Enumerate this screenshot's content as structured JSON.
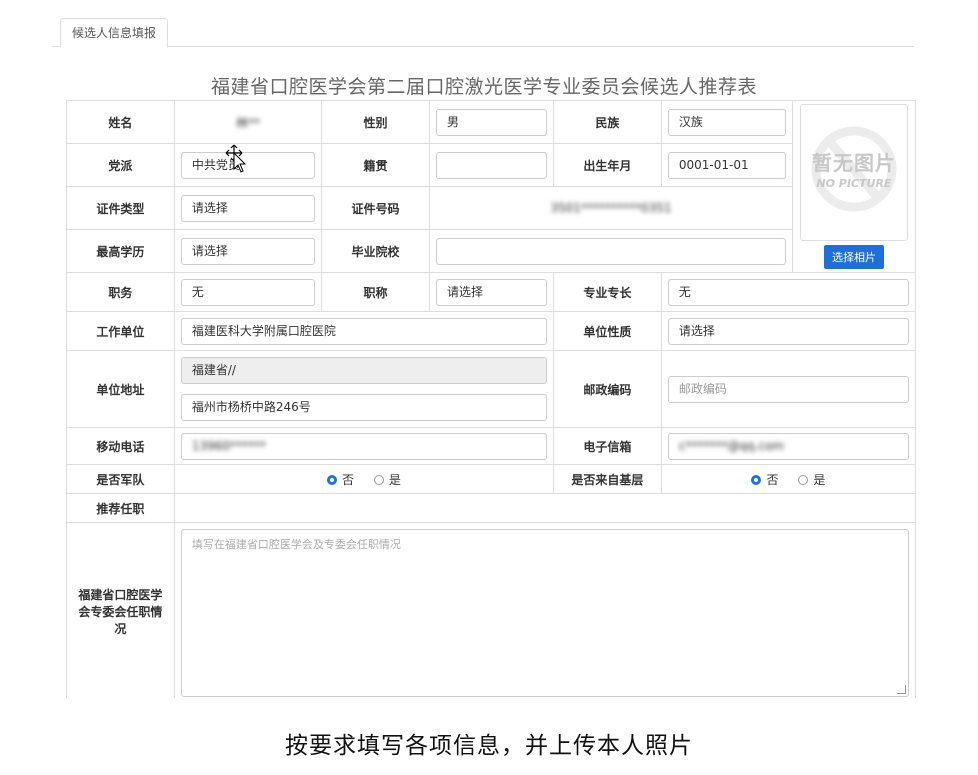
{
  "tab": {
    "label": "候选人信息填报"
  },
  "form_title": "福建省口腔医学会第二届口腔激光医学专业委员会候选人推荐表",
  "fields": {
    "name": {
      "label": "姓名",
      "value": "林**"
    },
    "gender": {
      "label": "性别",
      "value": "男"
    },
    "ethnicity": {
      "label": "民族",
      "value": "汉族"
    },
    "party": {
      "label": "党派",
      "value": "中共党员"
    },
    "hometown": {
      "label": "籍贯",
      "value": ""
    },
    "birth": {
      "label": "出生年月",
      "value": "0001-01-01"
    },
    "id_type": {
      "label": "证件类型",
      "value": "请选择"
    },
    "id_number": {
      "label": "证件号码",
      "value": "3501**********0351"
    },
    "education": {
      "label": "最高学历",
      "value": "请选择"
    },
    "school": {
      "label": "毕业院校",
      "value": ""
    },
    "position": {
      "label": "职务",
      "value": "无"
    },
    "title": {
      "label": "职称",
      "value": "请选择"
    },
    "specialty": {
      "label": "专业专长",
      "value": "无"
    },
    "work_unit": {
      "label": "工作单位",
      "value": "福建医科大学附属口腔医院"
    },
    "unit_nature": {
      "label": "单位性质",
      "value": "请选择"
    },
    "address": {
      "label": "单位地址",
      "region": "福建省//",
      "street": "福州市杨桥中路246号"
    },
    "postcode": {
      "label": "邮政编码",
      "placeholder": "邮政编码"
    },
    "mobile": {
      "label": "移动电话",
      "value": "13960******"
    },
    "email": {
      "label": "电子信箱",
      "value": "c*******@qq.com"
    },
    "military": {
      "label": "是否军队",
      "options": [
        "否",
        "是"
      ],
      "selected": "否"
    },
    "grassroots": {
      "label": "是否来自基层",
      "options": [
        "否",
        "是"
      ],
      "selected": "否"
    },
    "recommend": {
      "label": "推荐任职",
      "value": ""
    },
    "society_roles": {
      "label": "福建省口腔医学会专委会任职情况",
      "placeholder": "填写在福建省口腔医学会及专委会任职情况"
    }
  },
  "photo": {
    "placeholder_cn": "暂无图片",
    "placeholder_en": "NO PICTURE",
    "button_label": "选择相片"
  },
  "caption": "按要求填写各项信息，并上传本人照片",
  "colors": {
    "primary": "#1e6fd9",
    "border": "#dddddd",
    "radio": "#1a73e8"
  }
}
